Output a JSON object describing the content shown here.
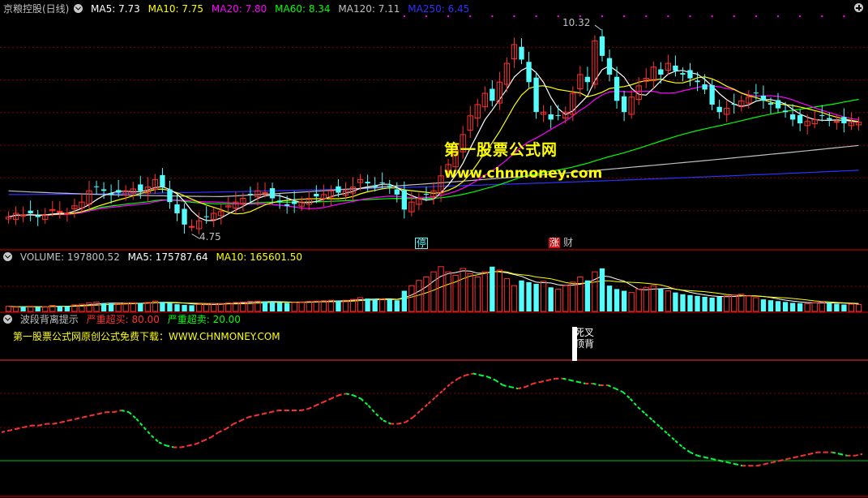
{
  "header": {
    "title": "京粮控股(日线)",
    "ma": [
      {
        "label": "MA5: 7.73",
        "color": "#ffffff"
      },
      {
        "label": "MA10: 7.75",
        "color": "#ffff00"
      },
      {
        "label": "MA20: 7.80",
        "color": "#ff00ff"
      },
      {
        "label": "MA60: 8.34",
        "color": "#00ff00"
      },
      {
        "label": "MA120: 7.11",
        "color": "#c0c0c0"
      },
      {
        "label": "MA250: 6.45",
        "color": "#3030ff"
      }
    ]
  },
  "price_labels": {
    "high": "10.32",
    "low": "4.75"
  },
  "watermark": {
    "line1": "第一股票公式网",
    "line2": "www.chnmoney.com"
  },
  "markers": {
    "limit_stop": "停",
    "limit_up": "涨",
    "finance": "财"
  },
  "volume_header": {
    "title": "VOLUME: 197800.52",
    "ma5": "MA5: 175787.64",
    "ma10": "MA10: 165601.50"
  },
  "indicator_header": {
    "title": "波段背离提示",
    "overbuy": "严重超买: 80.00",
    "oversell": "严重超卖: 20.00"
  },
  "promo_text": "第一股票公式网原创公式免费下载：WWW.CHNMONEY.COM",
  "signal_label": "死叉顶背",
  "colors": {
    "up": "#ff3232",
    "down": "#54fcfc",
    "ma5": "#ffffff",
    "ma10": "#ffff00",
    "ma20": "#ff00ff",
    "ma60": "#00ff00",
    "ma120": "#c0c0c0",
    "ma250": "#3030ff",
    "grid": "#8b0000",
    "panel_line": "#b00000"
  },
  "chart_data": [
    {
      "type": "candlestick",
      "ylim": [
        4.5,
        10.6
      ],
      "high": 10.32,
      "low": 4.75,
      "closes": [
        5.2,
        5.3,
        5.25,
        5.3,
        5.2,
        5.25,
        5.4,
        5.35,
        5.3,
        5.5,
        5.6,
        5.9,
        6.0,
        5.9,
        5.8,
        5.85,
        5.9,
        5.95,
        5.9,
        6.0,
        6.2,
        6.0,
        5.6,
        5.3,
        5.0,
        4.95,
        5.1,
        5.2,
        5.3,
        5.35,
        5.5,
        5.6,
        5.7,
        5.8,
        5.9,
        5.85,
        5.7,
        5.6,
        5.5,
        5.55,
        5.6,
        5.7,
        5.75,
        5.8,
        5.9,
        5.85,
        5.9,
        6.0,
        6.2,
        6.1,
        6.0,
        6.1,
        6.0,
        5.8,
        5.4,
        5.6,
        5.7,
        5.8,
        5.9,
        6.3,
        6.6,
        7.0,
        7.4,
        7.9,
        8.2,
        8.5,
        8.3,
        8.8,
        9.3,
        9.8,
        9.4,
        8.8,
        8.0,
        8.0,
        7.8,
        7.9,
        8.0,
        8.5,
        9.0,
        8.8,
        9.9,
        9.5,
        9.0,
        8.3,
        8.0,
        8.4,
        8.7,
        8.9,
        9.2,
        9.0,
        9.3,
        9.1,
        9.0,
        8.9,
        8.8,
        8.6,
        8.2,
        8.0,
        8.1,
        8.2,
        8.3,
        8.4,
        8.5,
        8.3,
        8.2,
        8.1,
        8.0,
        7.8,
        7.7,
        7.75,
        7.8,
        7.9,
        7.8,
        7.75,
        7.7,
        7.72,
        7.73
      ],
      "volumes": [
        30,
        25,
        28,
        30,
        26,
        28,
        35,
        32,
        30,
        38,
        42,
        50,
        55,
        48,
        45,
        46,
        48,
        50,
        48,
        52,
        60,
        55,
        50,
        42,
        38,
        36,
        40,
        42,
        45,
        46,
        50,
        52,
        55,
        58,
        60,
        58,
        55,
        52,
        50,
        52,
        55,
        58,
        60,
        62,
        65,
        62,
        65,
        70,
        80,
        75,
        70,
        72,
        70,
        65,
        120,
        150,
        180,
        200,
        230,
        260,
        230,
        210,
        250,
        220,
        200,
        230,
        260,
        240,
        190,
        150,
        180,
        170,
        160,
        175,
        140,
        130,
        150,
        170,
        200,
        180,
        230,
        250,
        150,
        130,
        120,
        110,
        130,
        140,
        150,
        130,
        120,
        110,
        100,
        95,
        90,
        85,
        80,
        85,
        90,
        95,
        100,
        90,
        80,
        70,
        65,
        60,
        55,
        50,
        48,
        46,
        50,
        55,
        50,
        45,
        40,
        42,
        40
      ],
      "ma_last": {
        "MA5": 7.73,
        "MA10": 7.75,
        "MA20": 7.8,
        "MA60": 8.34,
        "MA120": 7.11,
        "MA250": 6.45
      },
      "volume_last": {
        "VOLUME": 197800.52,
        "MA5": 175787.64,
        "MA10": 165601.5
      }
    },
    {
      "type": "line",
      "name": "波段背离提示",
      "ylim": [
        0,
        100
      ],
      "levels": {
        "overbuy": 80,
        "oversell": 20
      },
      "values": [
        37,
        38,
        39,
        40,
        41,
        41,
        42,
        42,
        43,
        44,
        45,
        46,
        47,
        48,
        49,
        49,
        50,
        49,
        45,
        40,
        35,
        31,
        29,
        28,
        28,
        29,
        30,
        32,
        34,
        37,
        39,
        42,
        44,
        46,
        47,
        48,
        49,
        50,
        50,
        50,
        50,
        51,
        53,
        55,
        57,
        59,
        60,
        59,
        57,
        53,
        48,
        44,
        42,
        42,
        43,
        46,
        50,
        54,
        58,
        62,
        66,
        69,
        71,
        72,
        71,
        70,
        68,
        65,
        64,
        63,
        64,
        66,
        67,
        68,
        69,
        69,
        68,
        67,
        66,
        66,
        65,
        65,
        63,
        61,
        57,
        52,
        48,
        44,
        40,
        36,
        32,
        28,
        25,
        23,
        22,
        21,
        20,
        19,
        18,
        17,
        17,
        17,
        18,
        19,
        20,
        21,
        22,
        23,
        24,
        25,
        25,
        25,
        24,
        23,
        23,
        24
      ]
    }
  ]
}
